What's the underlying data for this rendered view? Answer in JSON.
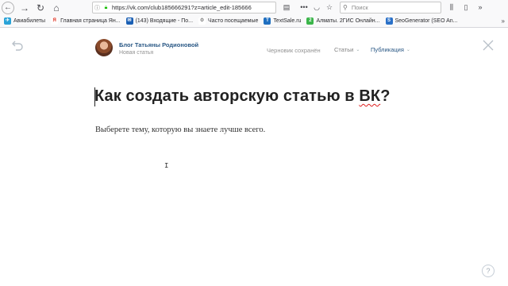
{
  "browser": {
    "url": "https://vk.com/club185666291?z=article_edit-185666",
    "search_placeholder": "Поиск",
    "icons": {
      "back": "back-arrow-icon",
      "forward": "forward-arrow-icon",
      "reload": "reload-icon",
      "home": "home-icon",
      "info": "info-icon",
      "lock": "lock-icon",
      "reader": "reader-view-icon",
      "more": "page-actions-icon",
      "pocket": "pocket-icon",
      "bookmark": "bookmark-star-icon",
      "library": "library-icon",
      "sidebar": "sidebar-icon",
      "overflow": "overflow-chevron-icon"
    }
  },
  "bookmarks": [
    {
      "label": "Авиабилеты",
      "color": "#2aa3d8",
      "glyph": "✈"
    },
    {
      "label": "Главная страница Ян...",
      "color": "#e03020",
      "glyph": "Я"
    },
    {
      "label": "(143) Входящие - По...",
      "color": "#1a5fb4",
      "glyph": "✉"
    },
    {
      "label": "Часто посещаемые",
      "color": "#8a8a8a",
      "glyph": "⚙"
    },
    {
      "label": "TextSale.ru",
      "color": "#1f6fc0",
      "glyph": "T"
    },
    {
      "label": "Алматы. 2ГИС Онлайн...",
      "color": "#3bb54a",
      "glyph": "2"
    },
    {
      "label": "SeoGenerator (SEO An...",
      "color": "#2a70c8",
      "glyph": "S"
    }
  ],
  "header": {
    "blog_name": "Блог Татьяны Родионовой",
    "article_status": "Новая статья",
    "draft_status": "Черновик сохранён",
    "articles_menu": "Статьи",
    "publish_menu": "Публикация"
  },
  "editor": {
    "title_main": "Как создать авторскую статью в ",
    "title_spell": "ВК",
    "title_end": "?",
    "body": "Выберете тему, которую вы знаете лучше всего."
  },
  "help_label": "?"
}
